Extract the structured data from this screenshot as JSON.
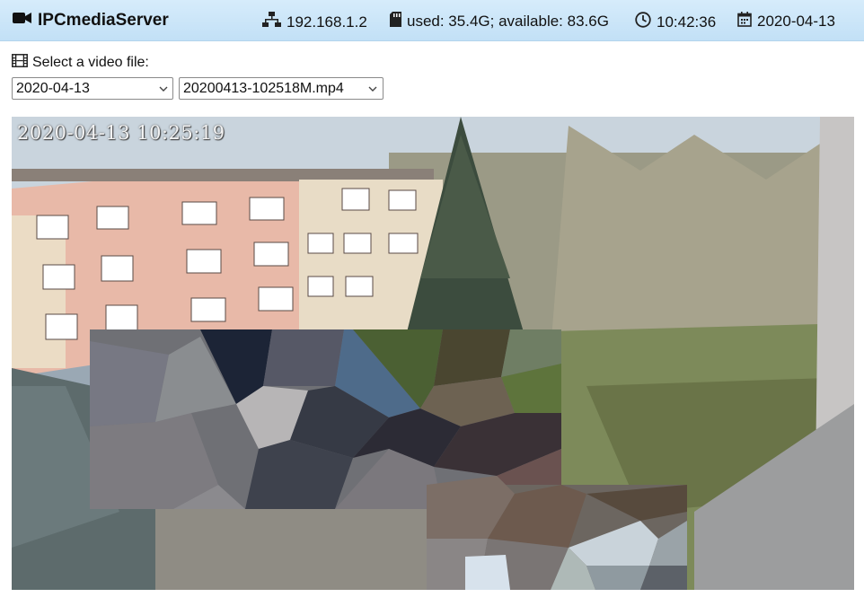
{
  "header": {
    "app_title": "IPCmediaServer",
    "ip": "192.168.1.2",
    "storage": "used: 35.4G; available: 83.6G",
    "time": "10:42:36",
    "date": "2020-04-13"
  },
  "selector": {
    "label": "Select a video file:",
    "date_value": "2020-04-13",
    "file_value": "20200413-102518M.mp4"
  },
  "video": {
    "timestamp": "2020-04-13 10:25:19"
  }
}
